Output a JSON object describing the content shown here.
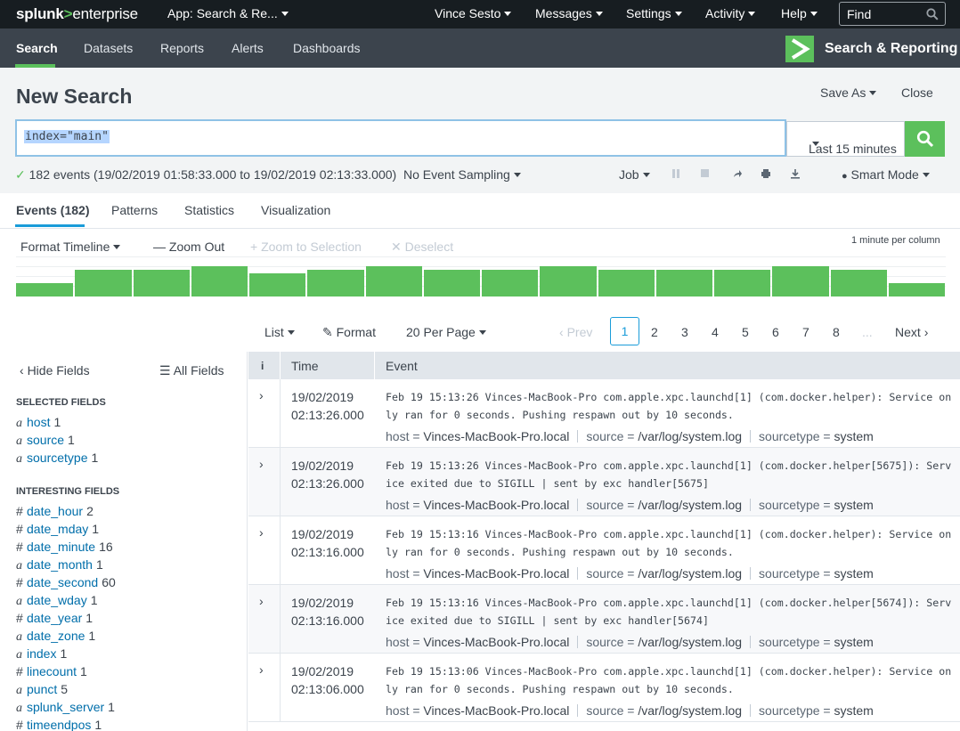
{
  "topbar": {
    "logo_a": "splunk",
    "logo_b": ">",
    "logo_c": "enterprise",
    "app": "App: Search & Re...",
    "user": "Vince Sesto",
    "messages": "Messages",
    "settings": "Settings",
    "activity": "Activity",
    "help": "Help",
    "find_placeholder": "Find"
  },
  "appbar": {
    "nav": [
      "Search",
      "Datasets",
      "Reports",
      "Alerts",
      "Dashboards"
    ],
    "app_name": "Search & Reporting"
  },
  "header": {
    "title": "New Search",
    "save_as": "Save As",
    "close": "Close"
  },
  "search": {
    "query": "index=\"main\"",
    "time_range": "Last 15 minutes"
  },
  "status": {
    "summary": "182 events (19/02/2019 01:58:33.000 to 19/02/2019 02:13:33.000)",
    "sampling": "No Event Sampling",
    "job": "Job",
    "mode": "Smart Mode"
  },
  "tabs": [
    "Events (182)",
    "Patterns",
    "Statistics",
    "Visualization"
  ],
  "timeline": {
    "format": "Format Timeline",
    "zoom_out": "Zoom Out",
    "zoom_selection": "Zoom to Selection",
    "deselect": "Deselect",
    "scale": "1 minute per column",
    "counts": [
      7,
      14,
      14,
      16,
      12,
      14,
      16,
      14,
      14,
      16,
      14,
      14,
      14,
      16,
      14,
      7
    ]
  },
  "pager": {
    "list": "List",
    "format": "Format",
    "per_page": "20 Per Page",
    "prev": "Prev",
    "pages": [
      "1",
      "2",
      "3",
      "4",
      "5",
      "6",
      "7",
      "8"
    ],
    "ellipsis": "...",
    "next": "Next"
  },
  "sidebar": {
    "hide_fields": "Hide Fields",
    "all_fields": "All Fields",
    "selected_heading": "SELECTED FIELDS",
    "selected": [
      {
        "type": "a",
        "name": "host",
        "count": "1"
      },
      {
        "type": "a",
        "name": "source",
        "count": "1"
      },
      {
        "type": "a",
        "name": "sourcetype",
        "count": "1"
      }
    ],
    "interesting_heading": "INTERESTING FIELDS",
    "interesting": [
      {
        "type": "#",
        "name": "date_hour",
        "count": "2"
      },
      {
        "type": "#",
        "name": "date_mday",
        "count": "1"
      },
      {
        "type": "#",
        "name": "date_minute",
        "count": "16"
      },
      {
        "type": "a",
        "name": "date_month",
        "count": "1"
      },
      {
        "type": "#",
        "name": "date_second",
        "count": "60"
      },
      {
        "type": "a",
        "name": "date_wday",
        "count": "1"
      },
      {
        "type": "#",
        "name": "date_year",
        "count": "1"
      },
      {
        "type": "a",
        "name": "date_zone",
        "count": "1"
      },
      {
        "type": "a",
        "name": "index",
        "count": "1"
      },
      {
        "type": "#",
        "name": "linecount",
        "count": "1"
      },
      {
        "type": "a",
        "name": "punct",
        "count": "5"
      },
      {
        "type": "a",
        "name": "splunk_server",
        "count": "1"
      },
      {
        "type": "#",
        "name": "timeendpos",
        "count": "1"
      }
    ]
  },
  "table": {
    "col_info": "i",
    "col_time": "Time",
    "col_event": "Event",
    "kv_host_key": "host =",
    "kv_source_key": "source =",
    "kv_sourcetype_key": "sourcetype =",
    "events": [
      {
        "date": "19/02/2019",
        "time": "02:13:26.000",
        "raw": "Feb 19 15:13:26 Vinces-MacBook-Pro com.apple.xpc.launchd[1] (com.docker.helper): Service only ran for 0 seconds. Pushing respawn out by 10 seconds.",
        "host": "Vinces-MacBook-Pro.local",
        "source": "/var/log/system.log",
        "sourcetype": "system"
      },
      {
        "date": "19/02/2019",
        "time": "02:13:26.000",
        "raw": "Feb 19 15:13:26 Vinces-MacBook-Pro com.apple.xpc.launchd[1] (com.docker.helper[5675]): Service exited due to SIGILL | sent by exc handler[5675]",
        "host": "Vinces-MacBook-Pro.local",
        "source": "/var/log/system.log",
        "sourcetype": "system"
      },
      {
        "date": "19/02/2019",
        "time": "02:13:16.000",
        "raw": "Feb 19 15:13:16 Vinces-MacBook-Pro com.apple.xpc.launchd[1] (com.docker.helper): Service only ran for 0 seconds. Pushing respawn out by 10 seconds.",
        "host": "Vinces-MacBook-Pro.local",
        "source": "/var/log/system.log",
        "sourcetype": "system"
      },
      {
        "date": "19/02/2019",
        "time": "02:13:16.000",
        "raw": "Feb 19 15:13:16 Vinces-MacBook-Pro com.apple.xpc.launchd[1] (com.docker.helper[5674]): Service exited due to SIGILL | sent by exc handler[5674]",
        "host": "Vinces-MacBook-Pro.local",
        "source": "/var/log/system.log",
        "sourcetype": "system"
      },
      {
        "date": "19/02/2019",
        "time": "02:13:06.000",
        "raw": "Feb 19 15:13:06 Vinces-MacBook-Pro com.apple.xpc.launchd[1] (com.docker.helper): Service only ran for 0 seconds. Pushing respawn out by 10 seconds.",
        "host": "Vinces-MacBook-Pro.local",
        "source": "/var/log/system.log",
        "sourcetype": "system"
      }
    ]
  },
  "colors": {
    "accent_green": "#5cc05c",
    "accent_blue": "#1a9cd9",
    "topbar_bg": "#171d21",
    "appbar_bg": "#3c444d"
  }
}
